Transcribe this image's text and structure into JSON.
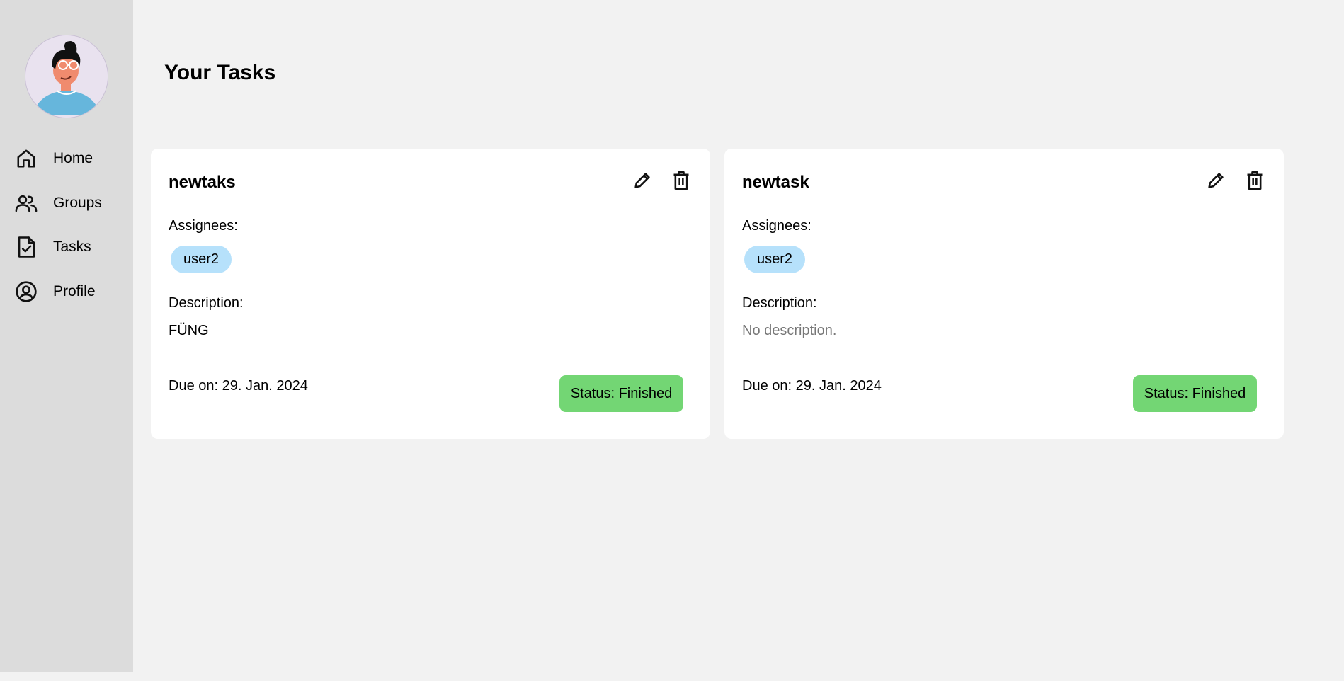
{
  "sidebar": {
    "avatar_icon": "user-avatar-illustration",
    "items": [
      {
        "label": "Home",
        "icon": "home-icon"
      },
      {
        "label": "Groups",
        "icon": "users-icon"
      },
      {
        "label": "Tasks",
        "icon": "task-document-check-icon"
      },
      {
        "label": "Profile",
        "icon": "user-circle-icon"
      }
    ]
  },
  "main": {
    "title": "Your Tasks",
    "tasks": [
      {
        "title": "newtaks",
        "assignees_label": "Assignees:",
        "assignees": [
          "user2"
        ],
        "description_label": "Description:",
        "description": "FÜNG",
        "due": "Due on: 29. Jan. 2024",
        "status": "Status: Finished"
      },
      {
        "title": "newtask",
        "assignees_label": "Assignees:",
        "assignees": [
          "user2"
        ],
        "description_label": "Description:",
        "description": "No description.",
        "due": "Due on: 29. Jan. 2024",
        "status": "Status: Finished"
      }
    ]
  },
  "colors": {
    "sidebar_bg": "#dcdcdc",
    "page_bg": "#f2f2f2",
    "card_bg": "#ffffff",
    "chip_bg": "#b6e1fb",
    "status_finished": "#73d674",
    "muted_text": "#777777"
  }
}
